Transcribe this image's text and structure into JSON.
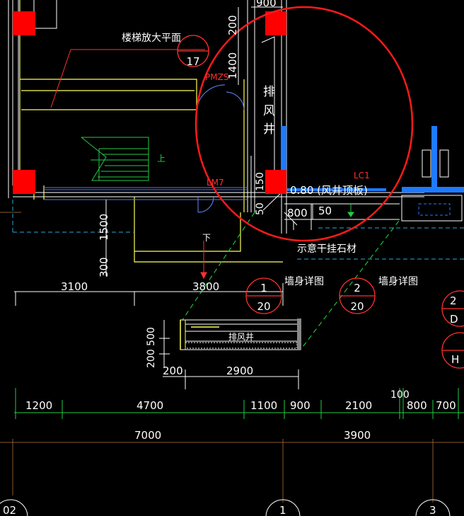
{
  "labels": {
    "stair_plan": "楼梯放大平面",
    "stair_plan_num": "17",
    "pm": "PMZS",
    "shaft_char_1": "排",
    "shaft_char_2": "风",
    "shaft_char_3": "井",
    "lc1": "LC1",
    "lm7": "LM7",
    "top_slab": "0.80 (风井顶板)",
    "dry_stone": "示意干挂石材",
    "down": "下",
    "up": "上",
    "wall_detail_1": "墙身详图",
    "wall_detail_2": "墙身详图",
    "bubble1_top": "1",
    "bubble1_bot": "20",
    "bubble2_top": "2",
    "bubble2_bot": "20",
    "bubble3_top": "2",
    "bubble3_bot": "D",
    "bubble4_top": "H",
    "shaft_detail": "排风井"
  },
  "dims": {
    "d900_top": "900",
    "d200_v": "200",
    "d1400_v": "1400",
    "d150": "150",
    "d50_v": "50",
    "d800_mid": "800",
    "d50_mid": "50",
    "d1500": "1500",
    "d300": "300",
    "d3100": "3100",
    "d3800": "3800",
    "d200500": "200 500",
    "d200_b": "200",
    "d2900": "2900",
    "g1200": "1200",
    "g4700": "4700",
    "g1100": "1100",
    "g900": "900",
    "g2100": "2100",
    "g100": "100",
    "g800": "800",
    "g700": "700",
    "t7000": "7000",
    "t3900": "3900"
  },
  "axes": {
    "a02": "02",
    "a1": "1",
    "a3": "3"
  },
  "colors": {
    "background": "#000000",
    "wall": "#ffffff",
    "yellow": "#ffff55",
    "column": "#ff0000",
    "blue_line": "#5577ff",
    "bright_blue": "#1e7bff",
    "cyan": "#2aa9d8",
    "green": "#22cc44",
    "dash_green": "#22dd44",
    "highlight_circle": "#ff1a1a",
    "axis_grid": "#8a5a2a"
  }
}
